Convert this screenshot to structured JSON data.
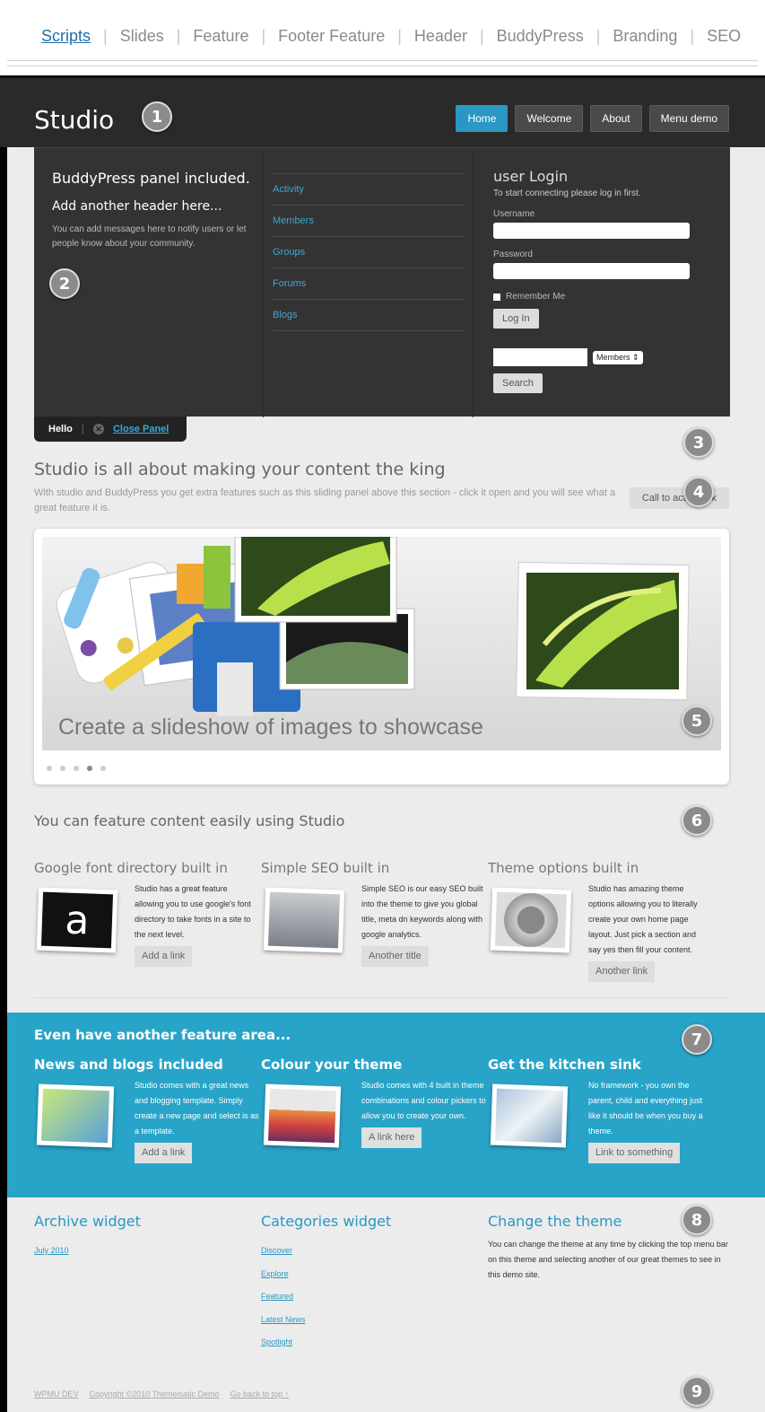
{
  "tabs": [
    "Scripts",
    "Slides",
    "Feature",
    "Footer Feature",
    "Header",
    "BuddyPress",
    "Branding",
    "SEO"
  ],
  "header": {
    "logo": "Studio",
    "nav": [
      "Home",
      "Welcome",
      "About",
      "Menu demo"
    ]
  },
  "badges": [
    "1",
    "2",
    "3",
    "4",
    "5",
    "6",
    "7",
    "8",
    "9"
  ],
  "panel": {
    "title": "BuddyPress panel included.",
    "subtitle": "Add another header here...",
    "text": "You can add messages here to notify users or let people know about your community.",
    "links": [
      "Activity",
      "Members",
      "Groups",
      "Forums",
      "Blogs"
    ],
    "login": {
      "title": "user Login",
      "subtitle": "To start connecting please log in first.",
      "username_label": "Username",
      "password_label": "Password",
      "remember": "Remember Me",
      "login_button": "Log In",
      "search_select": "Members",
      "search_button": "Search"
    },
    "tab": {
      "hello": "Hello",
      "close": "Close Panel"
    }
  },
  "intro": {
    "title": "Studio is all about making your content the king",
    "text": "With studio and BuddyPress you get extra features such as this sliding panel above this section - click it open and you will see what a great feature it is.",
    "cta": "Call to action link"
  },
  "slideshow": {
    "caption": "Create a slideshow of images to showcase",
    "dots": 5,
    "active_dot": 3
  },
  "features": {
    "title": "You can feature content easily using Studio",
    "items": [
      {
        "title": "Google font directory built in",
        "text": "Studio has a great feature allowing you to use google's font directory to take fonts in a site to the next level.",
        "button": "Add a link"
      },
      {
        "title": "Simple SEO built in",
        "text": "Simple SEO is our easy SEO built into the theme to give you global title, meta dn keywords along with google analytics.",
        "button": "Another title"
      },
      {
        "title": "Theme options built in",
        "text": "Studio has amazing theme options allowing you to literally create your own home page layout. Just pick a section and say yes then fill your content.",
        "button": "Another link"
      }
    ]
  },
  "footer_feature": {
    "title": "Even have another feature area...",
    "items": [
      {
        "title": "News and blogs included",
        "text": "Studio comes with a great news and blogging template. Simply create a new page and select is as a template.",
        "button": "Add a link"
      },
      {
        "title": "Colour your theme",
        "text": "Studio comes with 4 built in theme combinations and colour pickers to allow you to create your own.",
        "button": "A link here"
      },
      {
        "title": "Get the kitchen sink",
        "text": "No framework - you own the parent, child and everything just like it should be when you buy a theme.",
        "button": "Link to something"
      }
    ]
  },
  "widgets": {
    "archive": {
      "title": "Archive widget",
      "links": [
        "July 2010"
      ]
    },
    "categories": {
      "title": "Categories widget",
      "links": [
        "Discover",
        "Explore",
        "Featured",
        "Latest News",
        "Spotlight"
      ]
    },
    "theme": {
      "title": "Change the theme",
      "text": "You can change the theme at any time by clicking the top menu bar on this theme and selecting another of our great themes to see in this demo site."
    }
  },
  "footer": {
    "links": [
      "WPMU DEV",
      "Copyright ©2010 Themeisatic Demo",
      "Go back to top ↑"
    ]
  },
  "colors": {
    "accent": "#28a4c8",
    "header_bg": "#2a2a2a",
    "link": "#3aa9d9"
  }
}
